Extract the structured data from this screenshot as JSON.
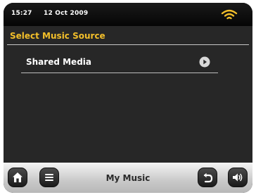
{
  "status_bar": {
    "time": "15:27",
    "date": "12 Oct 2009",
    "wifi_icon": "wifi-icon"
  },
  "main": {
    "title": "Select Music Source",
    "items": [
      {
        "label": "Shared Media",
        "icon": "play-icon"
      }
    ]
  },
  "toolbar": {
    "title": "My Music",
    "home_icon": "home-icon",
    "menu_icon": "menu-icon",
    "back_icon": "back-icon",
    "volume_icon": "volume-icon"
  },
  "colors": {
    "accent": "#f3bf2a",
    "background": "#272727",
    "text": "#ffffff"
  }
}
